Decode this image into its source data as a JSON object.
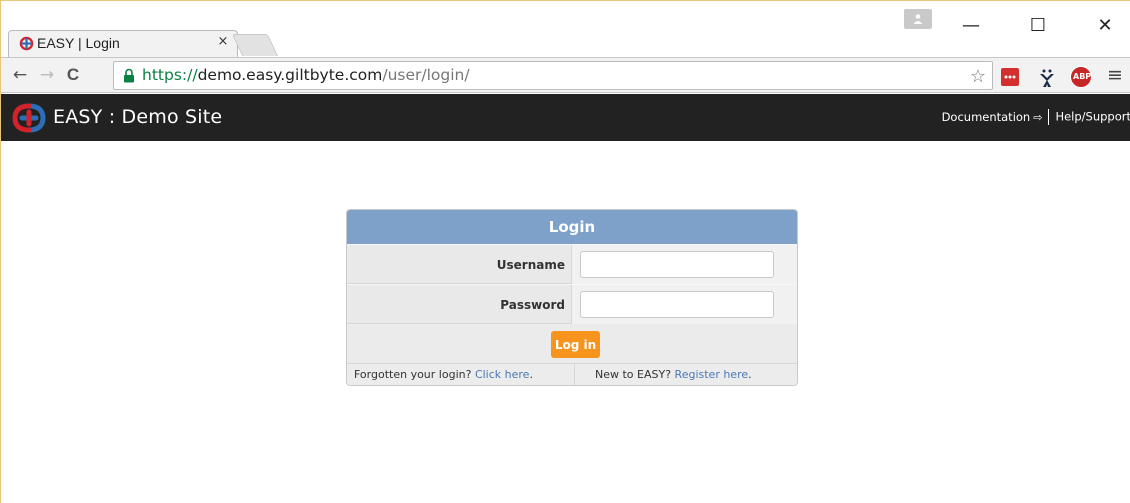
{
  "browser": {
    "tab": {
      "title": "EASY | Login",
      "close_glyph": "×"
    },
    "window_controls": {
      "minimize": "—",
      "maximize": "☐",
      "close": "✕"
    },
    "nav": {
      "back": "←",
      "forward": "→",
      "reload": "C"
    },
    "address": {
      "scheme": "https://",
      "host": "demo.easy.giltbyte.com",
      "path": "/user/login/"
    },
    "extensions": [
      "lastpass-icon",
      "spy-icon",
      "adblock-plus-icon"
    ],
    "adblock_label": "ABP",
    "menu_glyph": "≡",
    "star_glyph": "☆"
  },
  "site": {
    "title": "EASY : Demo Site",
    "links": {
      "documentation": "Documentation",
      "help": "Help/Support"
    },
    "colors": {
      "header_bg": "#222222",
      "login_head": "#7ea1c9",
      "button": "#f7941e",
      "link": "#4b78b3"
    }
  },
  "login": {
    "heading": "Login",
    "username_label": "Username",
    "password_label": "Password",
    "username_value": "",
    "password_value": "",
    "button_label": "Log in",
    "forgot_text": "Forgotten your login?",
    "forgot_link": "Click here",
    "new_text": "New to EASY?",
    "register_link": "Register here",
    "period": "."
  }
}
